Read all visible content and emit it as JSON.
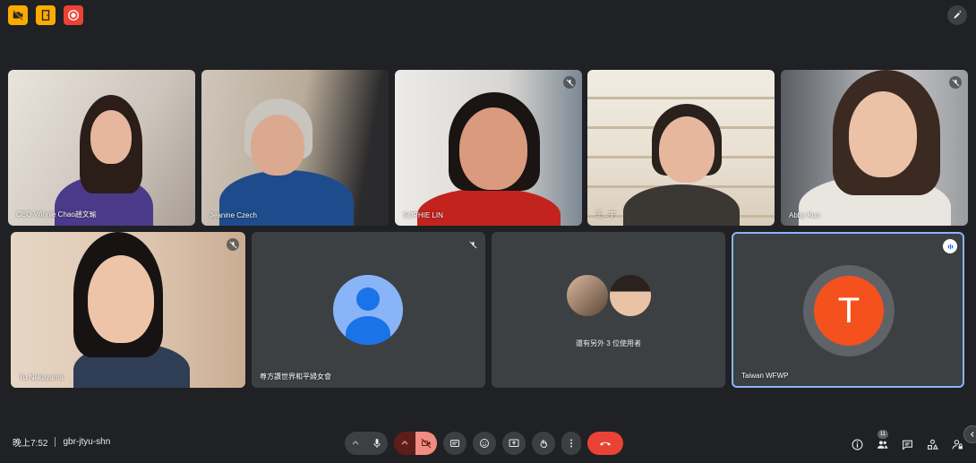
{
  "meeting": {
    "time": "晚上7:52",
    "code": "gbr-jtyu-shn"
  },
  "top_bar": {
    "icons": [
      "camera-off-icon",
      "door-icon",
      "record-icon"
    ]
  },
  "participants": [
    {
      "name": "CEO-Winnie Chao趙文瑜",
      "muted": false
    },
    {
      "name": "Jeanine Czech",
      "muted": false
    },
    {
      "name": "SOPHIE LIN",
      "muted": true
    },
    {
      "name": "王...宇",
      "muted": false
    },
    {
      "name": "Abby Kuo",
      "muted": true
    },
    {
      "name": "Yu Nakayama",
      "muted": true
    },
    {
      "name": "尊方讚世界和平婦女會",
      "muted": true
    },
    {
      "name": "Taiwan WFWP",
      "muted": false,
      "initial": "T",
      "speaking": true
    }
  ],
  "others_tile": {
    "label": "還有另外 3 位使用者"
  },
  "people_count": "11",
  "warning_badge": "!",
  "colors": {
    "background": "#202124",
    "tile": "#3c4043",
    "accent_blue": "#8ab4f8",
    "avatar_orange": "#f4511e",
    "hangup_red": "#ea4335"
  }
}
